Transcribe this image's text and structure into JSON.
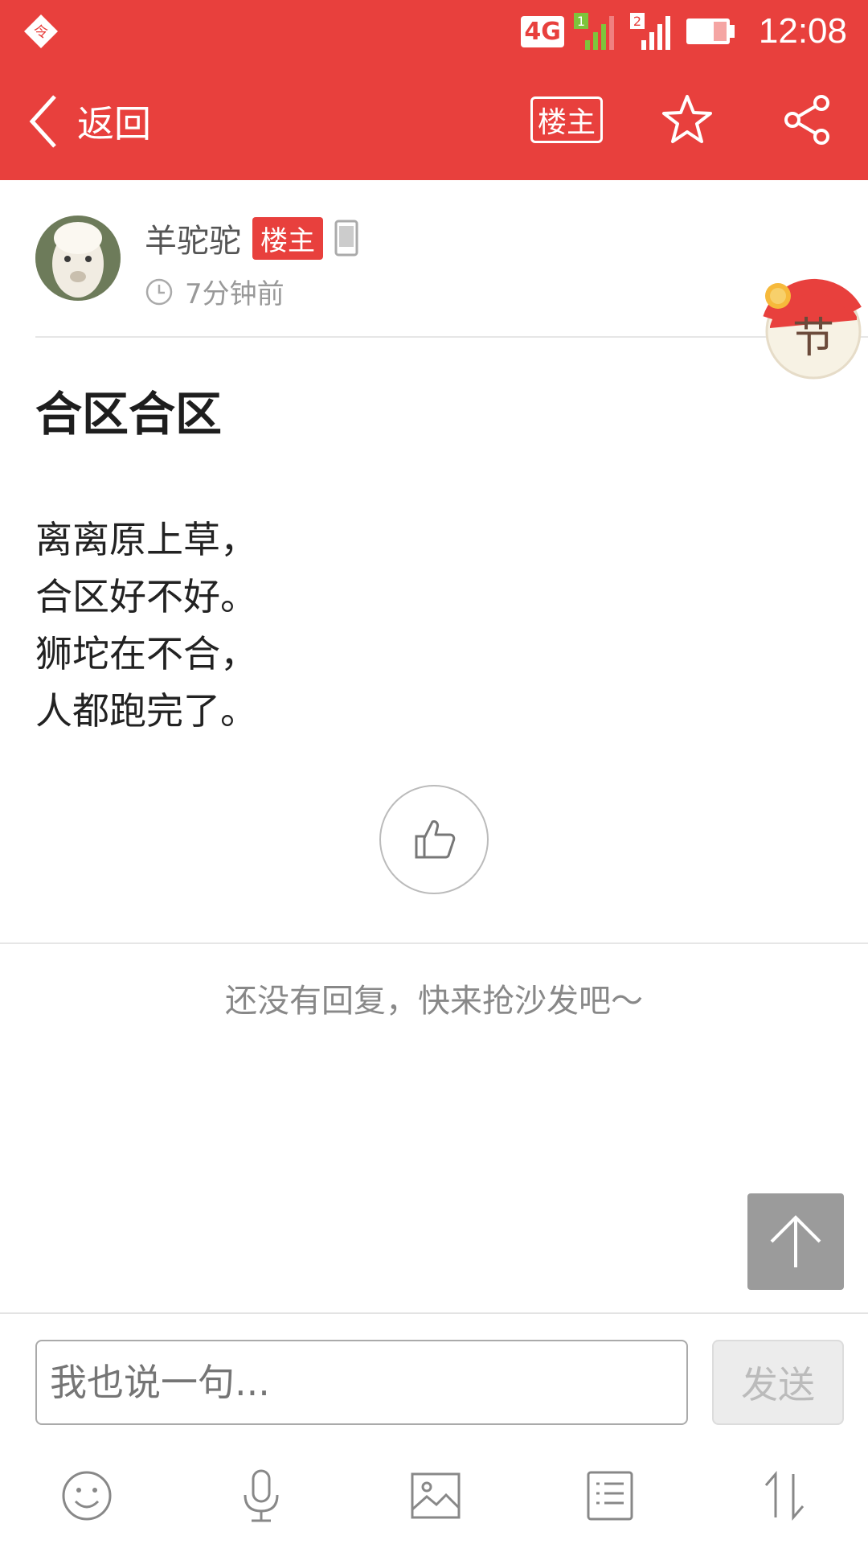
{
  "status_bar": {
    "network_label": "4G",
    "sim1_label": "1",
    "sim2_label": "2",
    "time": "12:08",
    "icons": [
      "app-notification-icon",
      "signal-icon",
      "battery-icon"
    ]
  },
  "navbar": {
    "back_label": "返回",
    "op_filter_label": "楼主",
    "icons": [
      "back-chevron-icon",
      "star-icon",
      "share-icon"
    ]
  },
  "author": {
    "name": "羊驼驼",
    "badge": "楼主",
    "posted_ago": "7分钟前",
    "icons": [
      "phone-icon",
      "clock-icon"
    ]
  },
  "festival_badge": {
    "label": "节"
  },
  "post": {
    "title": "合区合区",
    "lines": [
      "离离原上草，",
      "合区好不好。",
      "狮坨在不合，",
      "人都跑完了。"
    ]
  },
  "replies": {
    "empty_text": "还没有回复，快来抢沙发吧～"
  },
  "composer": {
    "placeholder": "我也说一句...",
    "send_label": "发送",
    "tool_icons": [
      "emoji-icon",
      "microphone-icon",
      "image-icon",
      "list-icon",
      "sort-icon"
    ]
  },
  "colors": {
    "brand_red": "#e8403d",
    "scroll_top_gray": "#9b9b9b"
  }
}
